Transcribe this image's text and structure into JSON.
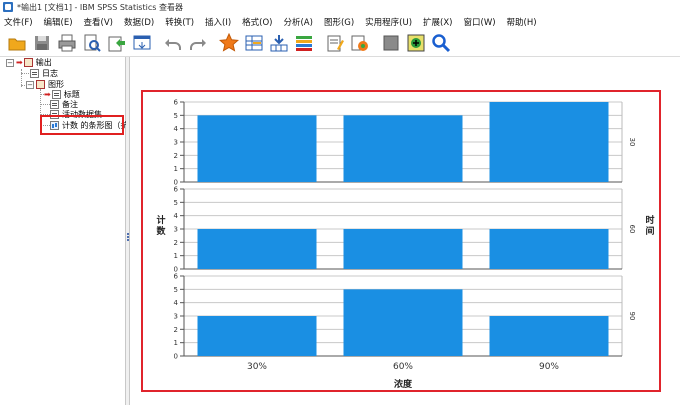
{
  "window": {
    "title": "*输出1 [文档1] - IBM SPSS Statistics 查看器"
  },
  "menu": [
    "文件(F)",
    "编辑(E)",
    "查看(V)",
    "数据(D)",
    "转换(T)",
    "插入(I)",
    "格式(O)",
    "分析(A)",
    "图形(G)",
    "实用程序(U)",
    "扩展(X)",
    "窗口(W)",
    "帮助(H)"
  ],
  "toolbar_icons": [
    "open-icon",
    "save-icon",
    "print-icon",
    "print-preview-icon",
    "export-icon",
    "recall-dialog-icon",
    "undo-icon",
    "redo-icon",
    "goto-data-icon",
    "goto-case-icon",
    "goto-variable-icon",
    "variables-icon",
    "show-all-icon",
    "designate-window-icon",
    "hide-icon",
    "insert-icon",
    "search-icon"
  ],
  "tree": {
    "root": "输出",
    "log": "日志",
    "graph": "图形",
    "title": "标题",
    "notes": "备注",
    "dataset": "活动数据集",
    "chart": "计数 的条形图（抗"
  },
  "chart_data": {
    "type": "bar",
    "categories": [
      "30%",
      "60%",
      "90%"
    ],
    "xlabel": "浓度",
    "ylabel": "计数",
    "panel_label": "时间",
    "ylim": [
      0,
      6
    ],
    "yticks": [
      0,
      1,
      2,
      3,
      4,
      5,
      6
    ],
    "bar_color": "#1a8fe3",
    "grid": true,
    "series": [
      {
        "name": "30",
        "values": [
          5,
          5,
          6
        ]
      },
      {
        "name": "60",
        "values": [
          3,
          3,
          3
        ]
      },
      {
        "name": "90",
        "values": [
          3,
          5,
          3
        ]
      }
    ]
  },
  "colors": {
    "highlight_border": "#e0242c"
  }
}
